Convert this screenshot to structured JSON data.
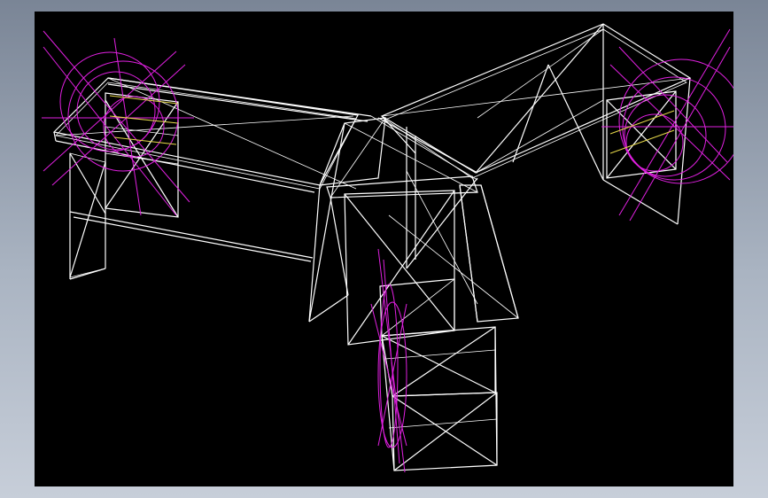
{
  "window": {
    "background": "#8b95a5"
  },
  "viewport": {
    "background": "#000000",
    "description_colors": {
      "edges": "#ffffff",
      "construction_circles": "#e020e0",
      "highlight_lines": "#e6d84a"
    }
  }
}
